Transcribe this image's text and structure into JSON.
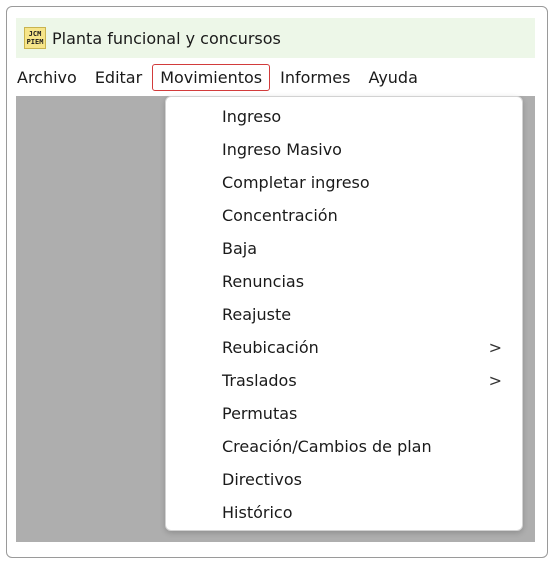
{
  "app": {
    "title": "Planta funcional y concursos",
    "icon_top": "JCM",
    "icon_bottom": "PIEM"
  },
  "menubar": [
    "Archivo",
    "Editar",
    "Movimientos",
    "Informes",
    "Ayuda"
  ],
  "active_menu": "Movimientos",
  "dropdown": [
    {
      "label": "Ingreso"
    },
    {
      "label": "Ingreso Masivo"
    },
    {
      "label": "Completar ingreso"
    },
    {
      "label": "Concentración"
    },
    {
      "label": "Baja"
    },
    {
      "label": "Renuncias"
    },
    {
      "label": "Reajuste"
    },
    {
      "label": "Reubicación",
      "submenu": ">"
    },
    {
      "label": "Traslados",
      "submenu": ">"
    },
    {
      "label": "Permutas"
    },
    {
      "label": "Creación/Cambios de plan"
    },
    {
      "label": "Directivos"
    },
    {
      "label": "Histórico"
    }
  ],
  "colors": {
    "titlebar_bg": "#edf7e8",
    "client_bg": "#aeaeae",
    "active_menu_border": "#d23b3b"
  }
}
